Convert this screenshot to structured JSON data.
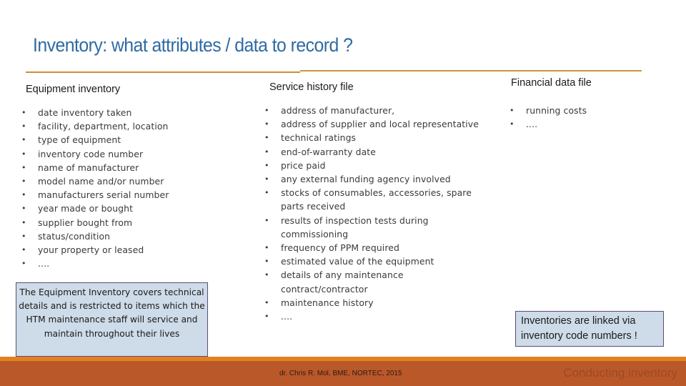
{
  "slide": {
    "title": "Inventory:  what attributes  /  data to record ?",
    "colors": {
      "title": "#2f6aa3",
      "accent_rule": "#d28a3a",
      "callout_fill": "#cedbe8",
      "callout_border": "#5b4d7a",
      "footer_strip": "#e2821e",
      "footer_band": "#bb582a"
    }
  },
  "columns": [
    {
      "heading": "Equipment inventory",
      "items": [
        "date inventory taken",
        "facility, department, location",
        "type of equipment",
        "inventory code number",
        "name of manufacturer",
        "model name and/or number",
        "manufacturers serial number",
        "year made or bought",
        "supplier bought from",
        "status/condition",
        "your property or leased",
        "...."
      ]
    },
    {
      "heading": "Service history file",
      "items": [
        "address of manufacturer,",
        "address of supplier and local representative",
        "technical ratings",
        "end-of-warranty date",
        "price paid",
        "any external funding agency involved",
        "stocks of consumables, accessories, spare parts received",
        "results of inspection tests during commissioning",
        "frequency of PPM required",
        "estimated value of the equipment",
        "details of any maintenance contract/contractor",
        "maintenance history",
        "...."
      ]
    },
    {
      "heading": "Financial data file",
      "items": [
        "running costs",
        "...."
      ]
    }
  ],
  "callouts": {
    "equipment_note": "The Equipment Inventory covers technical details and is restricted to items which the HTM maintenance staff will service and maintain throughout their lives",
    "link_note": "Inventories are linked via inventory code numbers !"
  },
  "footer": {
    "credit": "dr. Chris R. Mol, BME, NORTEC, 2015",
    "section": "Conducting inventory"
  },
  "bullet_glyph": "•"
}
